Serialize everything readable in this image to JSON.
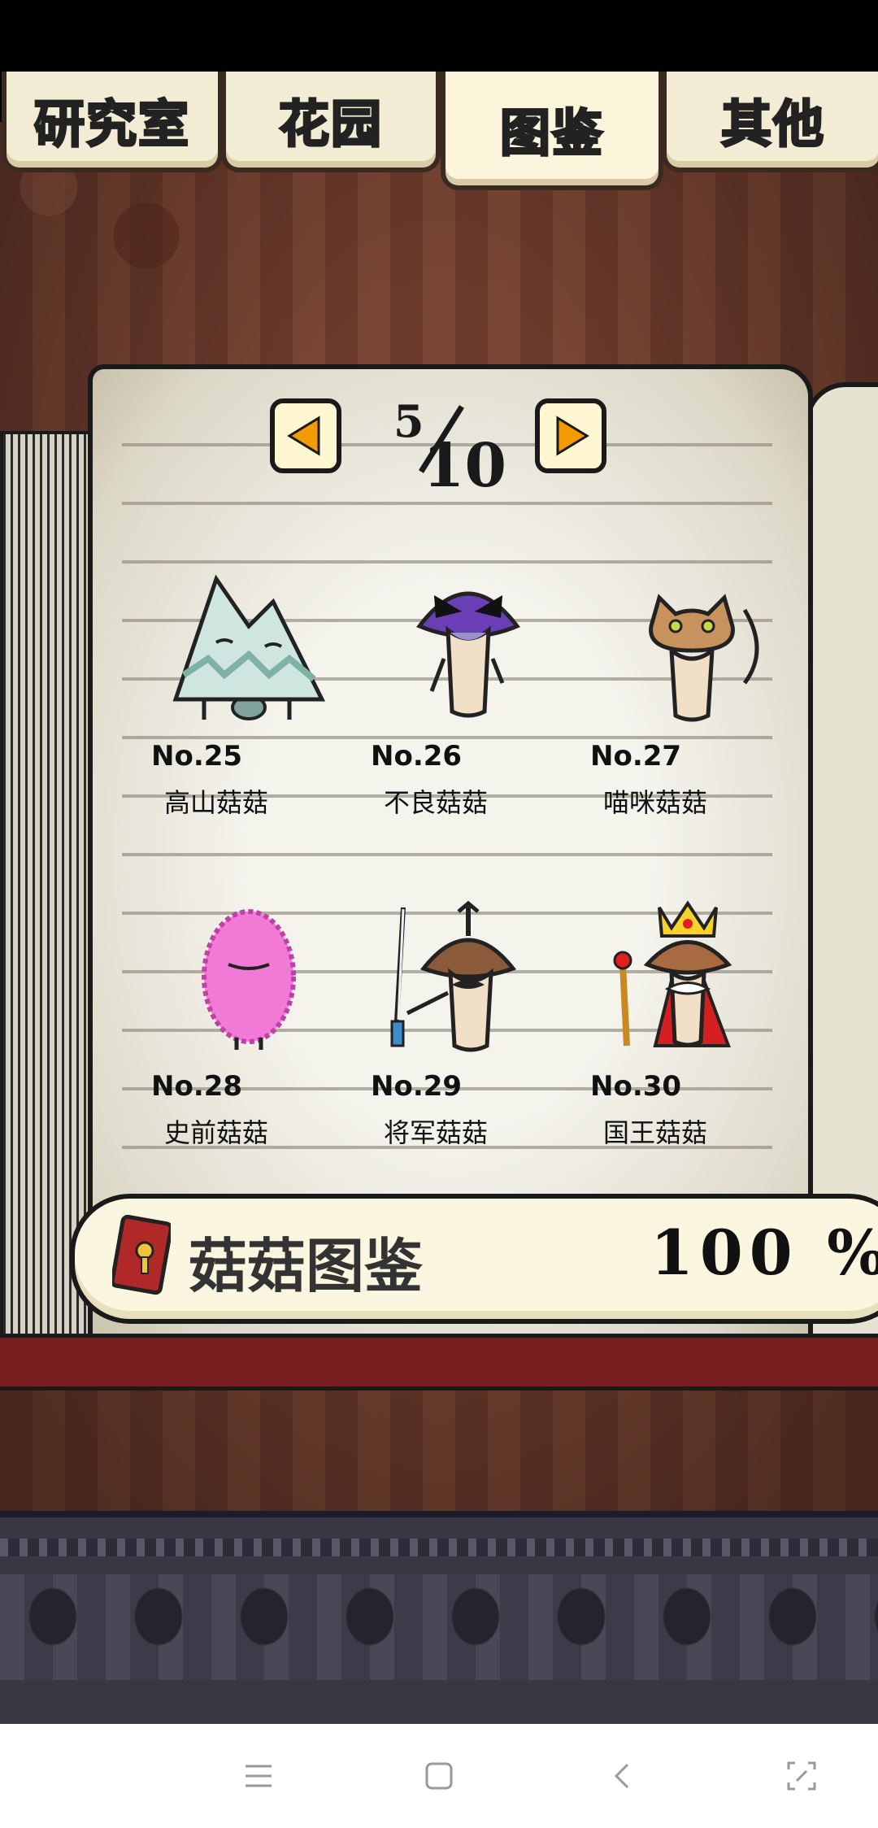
{
  "tabs": [
    {
      "label": "研究室",
      "active": false
    },
    {
      "label": "花园",
      "active": false
    },
    {
      "label": "图鉴",
      "active": true
    },
    {
      "label": "其他",
      "active": false
    }
  ],
  "pager": {
    "current": "5",
    "total": "10"
  },
  "entries": [
    {
      "number": "No.25",
      "name": "高山菇菇",
      "icon": "mountain-mushroom-icon"
    },
    {
      "number": "No.26",
      "name": "不良菇菇",
      "icon": "delinquent-mushroom-icon"
    },
    {
      "number": "No.27",
      "name": "喵咪菇菇",
      "icon": "cat-mushroom-icon"
    },
    {
      "number": "No.28",
      "name": "史前菇菇",
      "icon": "prehistoric-mushroom-icon"
    },
    {
      "number": "No.29",
      "name": "将军菇菇",
      "icon": "general-mushroom-icon"
    },
    {
      "number": "No.30",
      "name": "国王菇菇",
      "icon": "king-mushroom-icon"
    }
  ],
  "completion": {
    "label": "菇菇图鉴",
    "percent": "100 %",
    "value_percent": 100,
    "icon": "book-icon"
  },
  "colors": {
    "active_tab_text": "#ffd800",
    "arrow": "#f29a00",
    "cover": "#7a1f1f"
  },
  "system_nav": {
    "icons": [
      "menu-icon",
      "home-icon",
      "back-icon",
      "screenshot-icon"
    ]
  }
}
